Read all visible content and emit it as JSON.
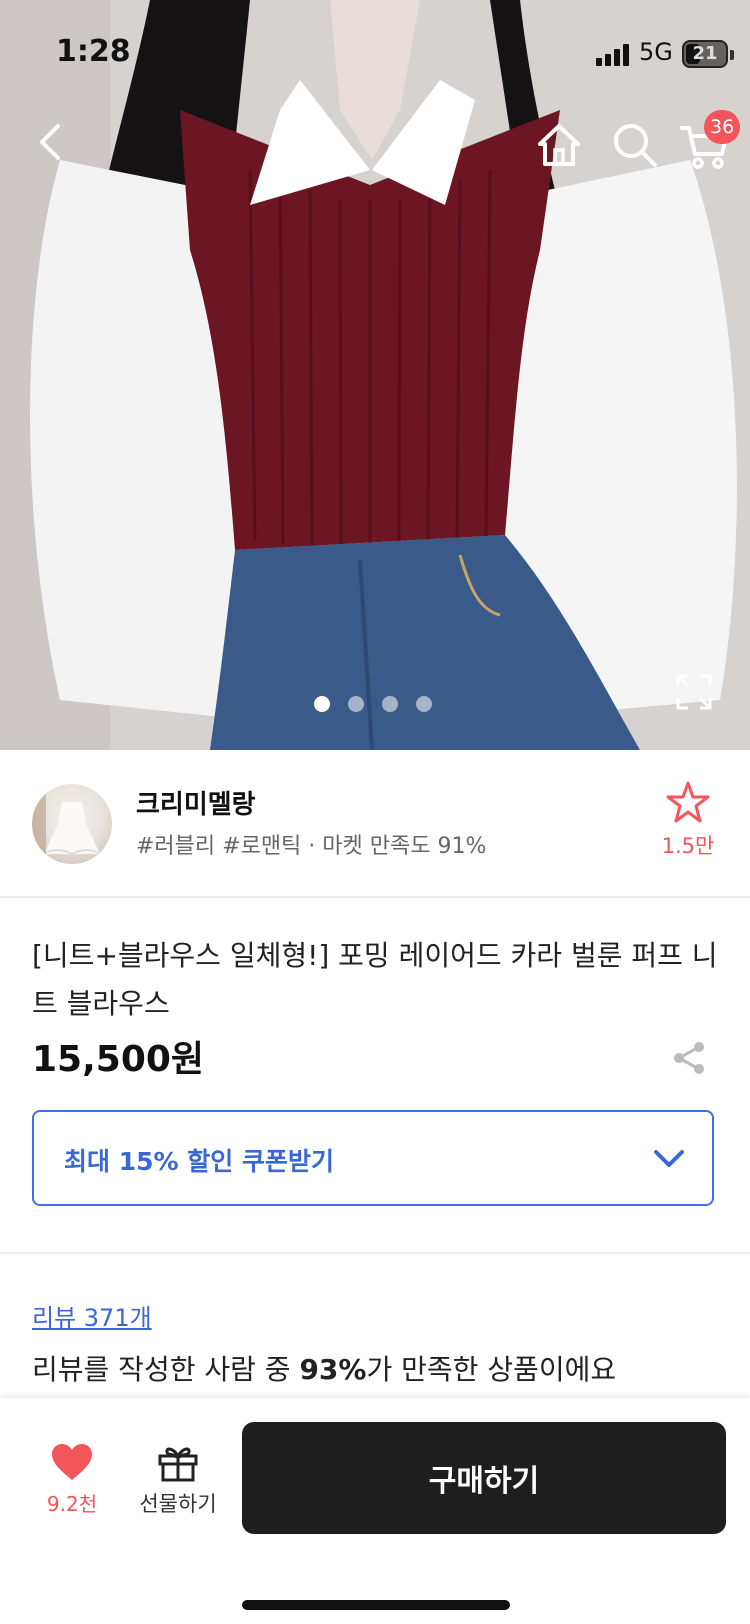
{
  "status_bar": {
    "time": "1:28",
    "network": "5G",
    "battery": "21"
  },
  "header": {
    "cart_badge": "36",
    "icons": [
      "back-icon",
      "home-icon",
      "search-icon",
      "cart-icon"
    ]
  },
  "gallery": {
    "image_count": 4,
    "active_index": 0
  },
  "shop": {
    "name": "크리미멜랑",
    "tags": "#러블리 #로맨틱 · 마켓 만족도 91%",
    "favorite_count": "1.5만"
  },
  "product": {
    "title": "[니트+블라우스 일체형!] 포밍 레이어드 카라 벌룬 퍼프 니트 블라우스",
    "price": "15,500원",
    "coupon_label": "최대 15% 할인 쿠폰받기"
  },
  "reviews": {
    "link_label": "리뷰 371개",
    "summary_prefix": "리뷰를 작성한 사람 중 ",
    "summary_highlight": "93%",
    "summary_suffix": "가 만족한 상품이에요"
  },
  "bottom_bar": {
    "like_count": "9.2천",
    "gift_label": "선물하기",
    "buy_label": "구매하기"
  },
  "colors": {
    "accent_blue": "#3a67d8",
    "accent_red": "#f2555a",
    "buy_button": "#1e1e1e"
  }
}
